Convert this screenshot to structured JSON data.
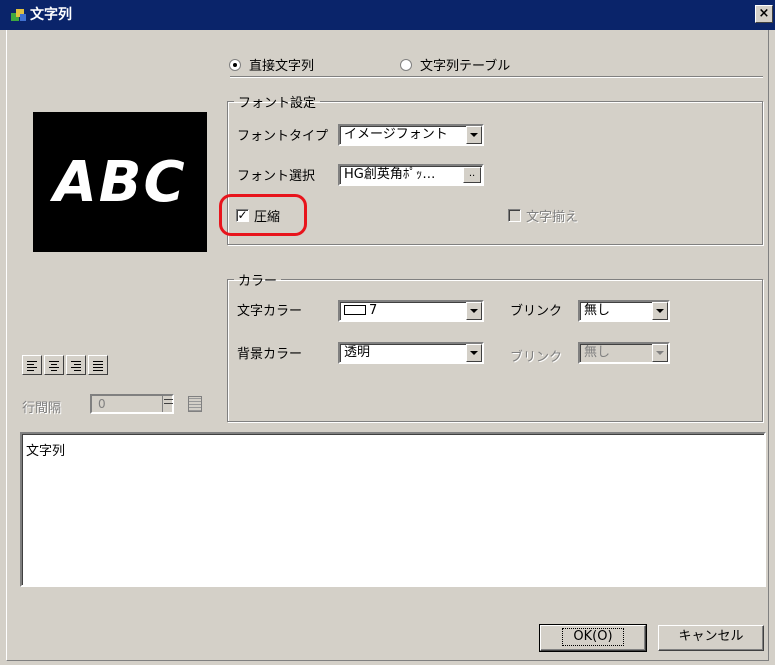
{
  "window": {
    "title": "文字列",
    "close_symbol": "×"
  },
  "source_radio": {
    "direct_label": "直接文字列",
    "table_label": "文字列テーブル",
    "selected": "direct"
  },
  "preview": {
    "text": "ABC"
  },
  "font_settings": {
    "legend": "フォント設定",
    "type_label": "フォントタイプ",
    "type_value": "イメージフォント",
    "select_label": "フォント選択",
    "select_value": "HG創英角ﾎﾟｯ…",
    "select_button": "..",
    "compress_label": "圧縮",
    "compress_checked": true,
    "justify_label": "文字揃え",
    "justify_checked": false
  },
  "color_settings": {
    "legend": "カラー",
    "text_color_label": "文字カラー",
    "text_color_value": "7",
    "text_blink_label": "ブリンク",
    "text_blink_value": "無し",
    "bg_color_label": "背景カラー",
    "bg_color_value": "透明",
    "bg_blink_label": "ブリンク",
    "bg_blink_value": "無し"
  },
  "alignment": {
    "line_spacing_label": "行間隔",
    "line_spacing_value": "0"
  },
  "text_area": {
    "value": "文字列"
  },
  "buttons": {
    "ok": "OK(O)",
    "cancel": "キャンセル"
  },
  "colors": {
    "title_bar": "#0a246a",
    "dialog_bg": "#d4d0c8",
    "highlight": "#e8141c"
  }
}
